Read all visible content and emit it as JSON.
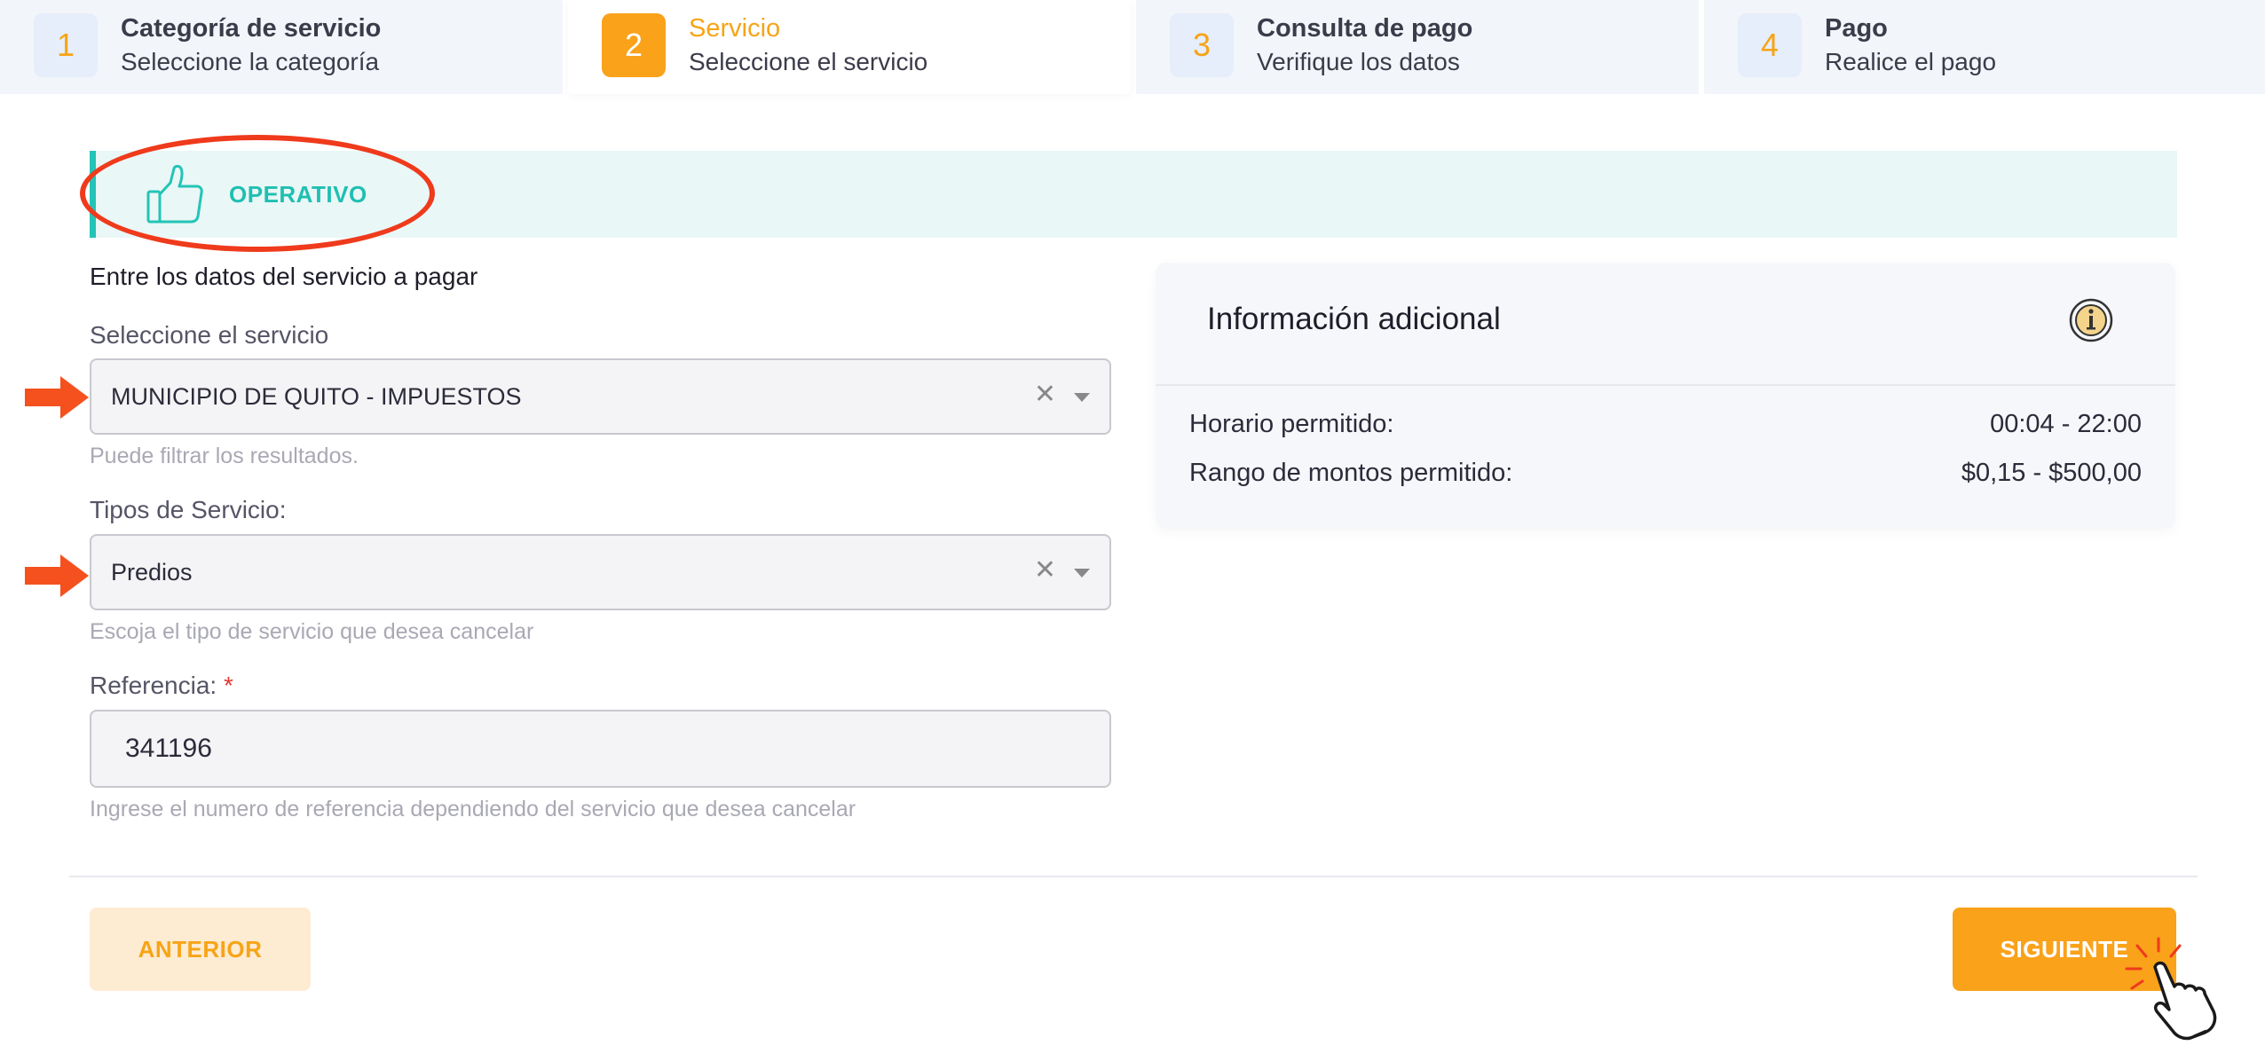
{
  "stepper": {
    "steps": [
      {
        "number": "1",
        "title": "Categoría de servicio",
        "subtitle": "Seleccione la categoría",
        "active": false
      },
      {
        "number": "2",
        "title": "Servicio",
        "subtitle": "Seleccione el servicio",
        "active": true
      },
      {
        "number": "3",
        "title": "Consulta de pago",
        "subtitle": "Verifique los datos",
        "active": false
      },
      {
        "number": "4",
        "title": "Pago",
        "subtitle": "Realice el pago",
        "active": false
      }
    ]
  },
  "status": {
    "label": "OPERATIVO",
    "icon": "thumbs-up-icon",
    "color": "#1fbfb2",
    "highlight_color": "#ef3a1c"
  },
  "form": {
    "heading": "Entre los datos del servicio a pagar",
    "service": {
      "label": "Seleccione el servicio",
      "value": "MUNICIPIO DE QUITO - IMPUESTOS",
      "hint": "Puede filtrar los resultados."
    },
    "service_type": {
      "label": "Tipos de Servicio:",
      "value": "Predios",
      "hint": "Escoja el tipo de servicio que desea cancelar"
    },
    "reference": {
      "label": "Referencia:",
      "required_mark": "*",
      "value": "341196",
      "hint": "Ingrese el numero de referencia dependiendo del servicio que desea cancelar"
    }
  },
  "info": {
    "title": "Información adicional",
    "icon": "info-icon",
    "rows": [
      {
        "key": "Horario permitido:",
        "value": "00:04 - 22:00"
      },
      {
        "key": "Rango de montos permitido:",
        "value": "$0,15 - $500,00"
      }
    ]
  },
  "buttons": {
    "previous": "ANTERIOR",
    "next": "SIGUIENTE"
  },
  "colors": {
    "accent": "#f9a21a",
    "arrow": "#f4511e",
    "teal": "#23c4b7"
  }
}
